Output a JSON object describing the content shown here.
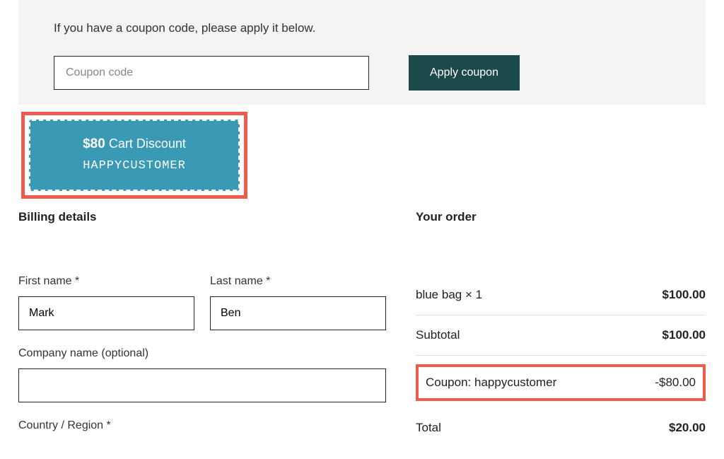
{
  "coupon": {
    "prompt": "If you have a coupon code, please apply it below.",
    "placeholder": "Coupon code",
    "apply_label": "Apply coupon"
  },
  "ticket": {
    "amount": "$80",
    "label": "Cart Discount",
    "code": "HAPPYCUSTOMER"
  },
  "billing": {
    "title": "Billing details",
    "first_name_label": "First name *",
    "first_name_value": "Mark",
    "last_name_label": "Last name *",
    "last_name_value": "Ben",
    "company_label": "Company name (optional)",
    "company_value": "",
    "country_label": "Country / Region *"
  },
  "order": {
    "title": "Your order",
    "item_label": "blue bag  × 1",
    "item_price": "$100.00",
    "subtotal_label": "Subtotal",
    "subtotal_price": "$100.00",
    "coupon_label": "Coupon: happycustomer",
    "coupon_price": "-$80.00",
    "total_label": "Total",
    "total_price": "$20.00"
  }
}
